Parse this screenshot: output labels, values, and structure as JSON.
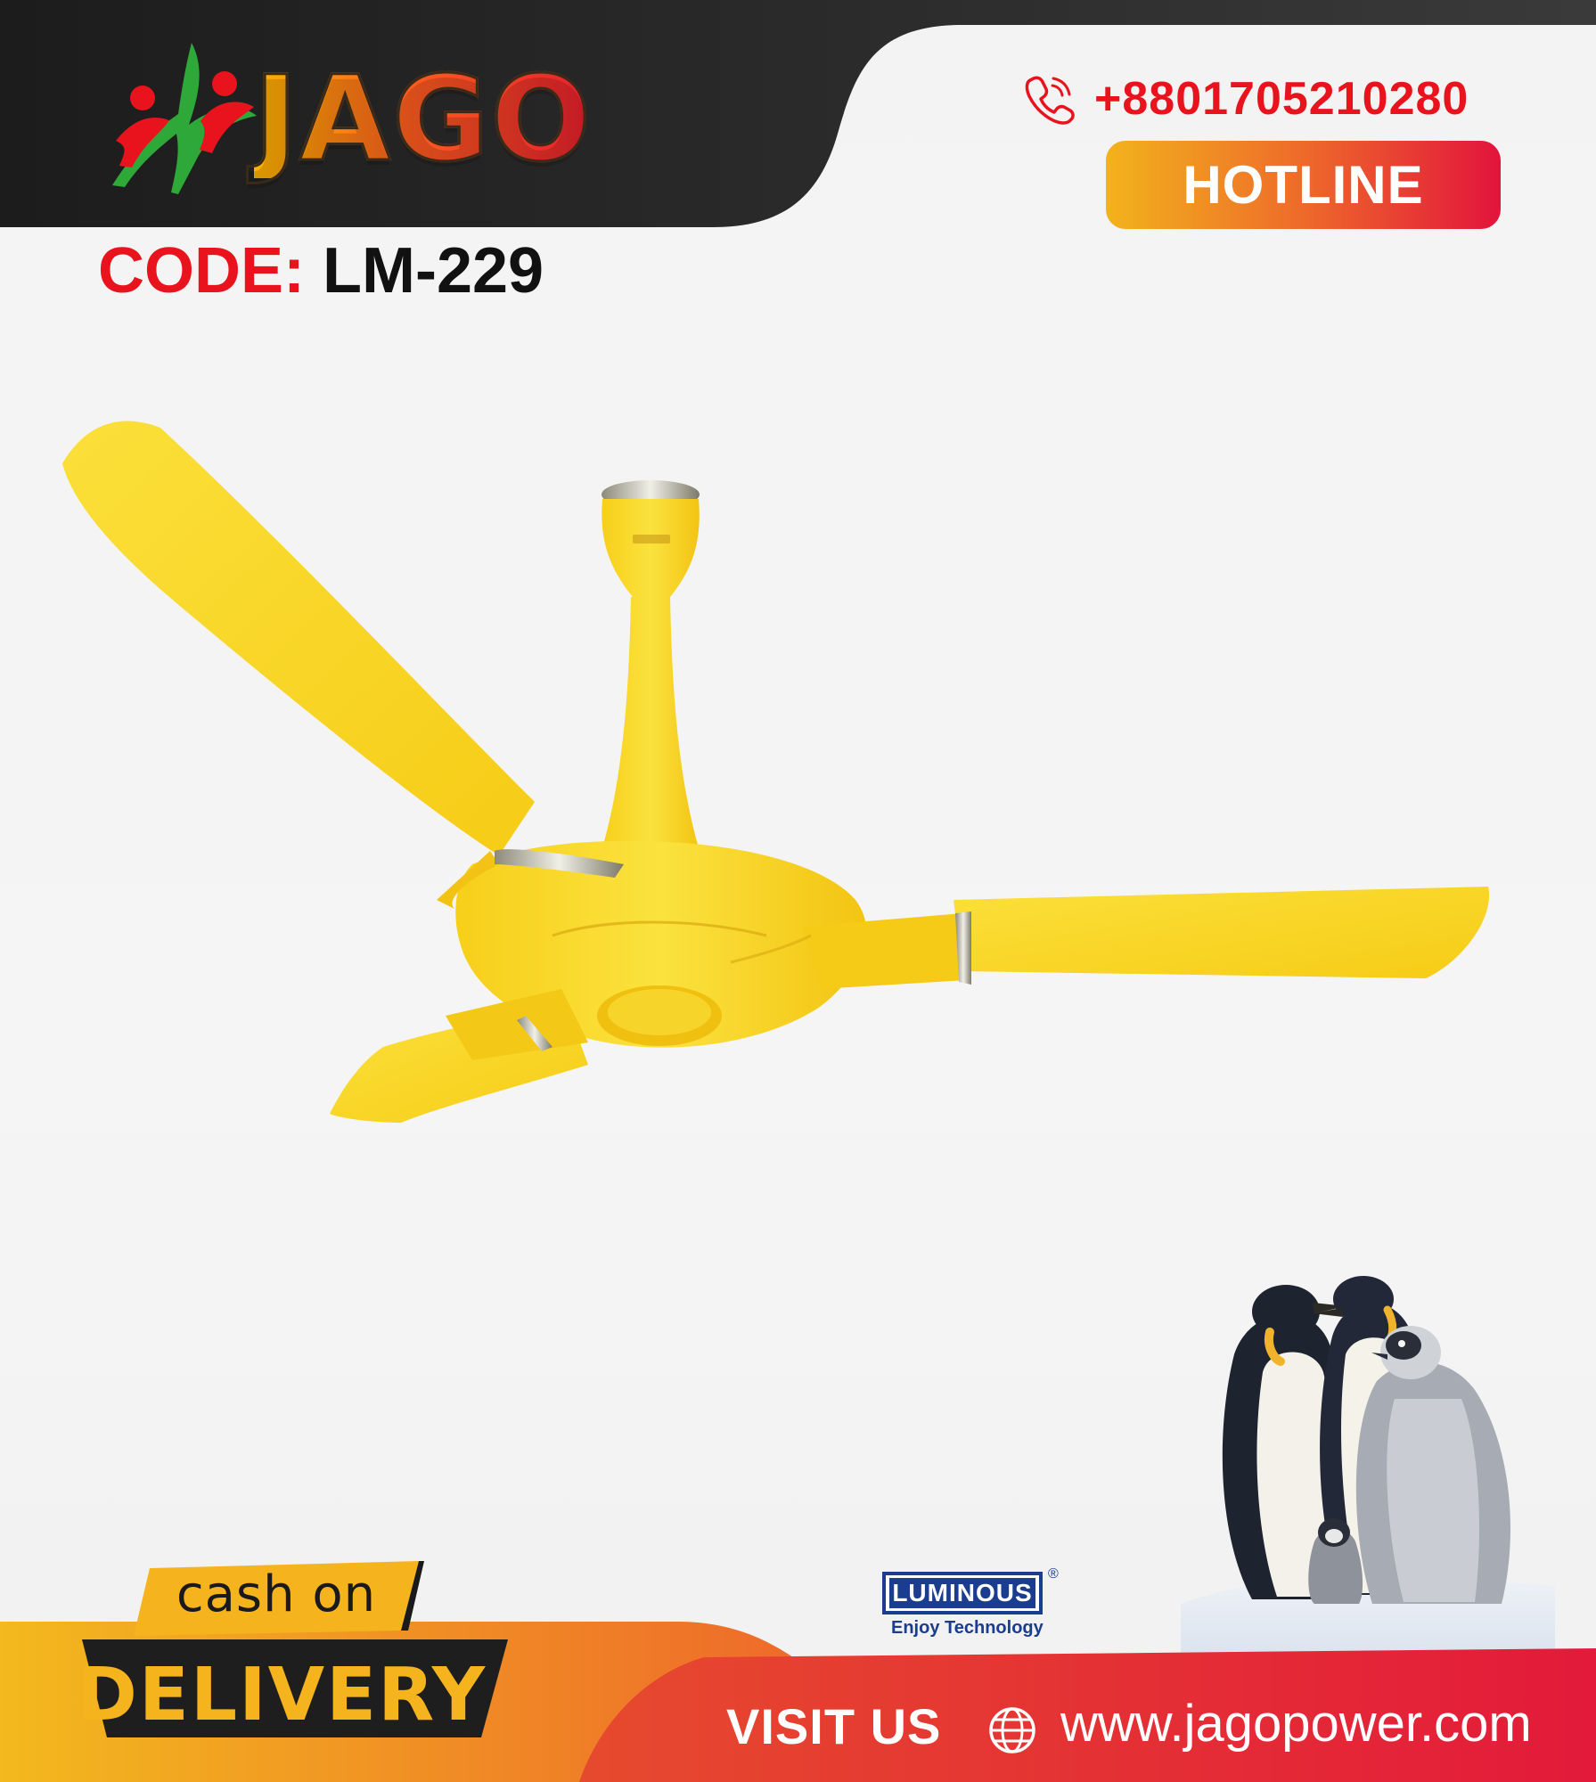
{
  "brand": {
    "logo_text": "JAGO",
    "colors": {
      "red": "#e8131d",
      "orange": "#ee6a2a",
      "yellow": "#f5b41e",
      "dark": "#1e1e1e"
    }
  },
  "header": {
    "phone_icon": "phone-icon",
    "phone_number": "+8801705210280",
    "hotline_label": "HOTLINE"
  },
  "product": {
    "code_label": "CODE:",
    "code_value": "LM-229",
    "fan_color": "#f9d623"
  },
  "partner": {
    "name": "LUMINOUS",
    "registered": "®",
    "tagline": "Enjoy Technology"
  },
  "footer": {
    "cash_label": "cash on",
    "delivery_label": "DELIVERY",
    "visit_label": "VISIT US",
    "globe_icon": "globe-icon",
    "website": "www.jagopower.com"
  }
}
